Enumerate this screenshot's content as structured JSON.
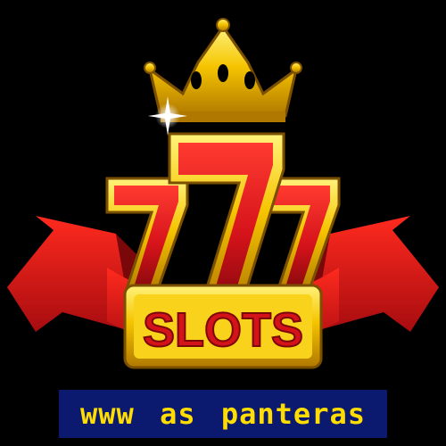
{
  "logo": {
    "digits": [
      "7",
      "7",
      "7"
    ],
    "word": "SLOTS",
    "icon_name": "crown-icon"
  },
  "caption": {
    "text": "www as panteras"
  },
  "colors": {
    "background": "#000000",
    "gold": "#f5c400",
    "red": "#d4121a",
    "dark_red": "#8a0a0e",
    "caption_bg": "#0b1a6f",
    "caption_text": "#ffdd00"
  }
}
